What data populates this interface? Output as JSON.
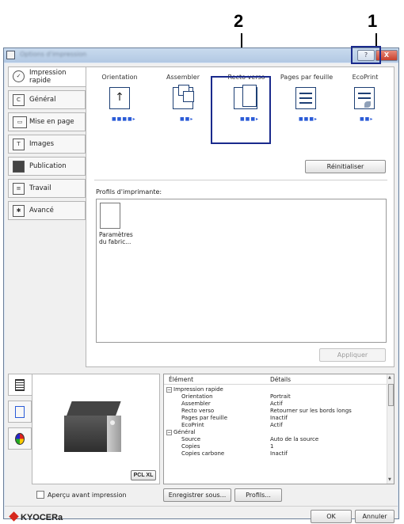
{
  "callouts": {
    "one": "1",
    "two": "2"
  },
  "window": {
    "title": "Options d'impression",
    "help": "?",
    "close": "X"
  },
  "sidebar": {
    "items": [
      {
        "label": "Impression rapide",
        "icon": "quick-print-icon"
      },
      {
        "label": "Général",
        "icon": "general-icon"
      },
      {
        "label": "Mise en page",
        "icon": "layout-icon"
      },
      {
        "label": "Images",
        "icon": "images-icon"
      },
      {
        "label": "Publication",
        "icon": "publishing-icon"
      },
      {
        "label": "Travail",
        "icon": "job-icon"
      },
      {
        "label": "Avancé",
        "icon": "advanced-icon"
      }
    ]
  },
  "quick": {
    "features": [
      {
        "label": "Orientation",
        "icon": "orientation-icon"
      },
      {
        "label": "Assembler",
        "icon": "collate-icon"
      },
      {
        "label": "Recto verso",
        "icon": "duplex-icon"
      },
      {
        "label": "Pages par feuille",
        "icon": "pages-per-sheet-icon"
      },
      {
        "label": "EcoPrint",
        "icon": "ecoprint-icon"
      }
    ],
    "reset": "Réinitialiser",
    "profiles_label": "Profils d'imprimante:",
    "profile_item": "Paramètres du fabric...",
    "apply": "Appliquer"
  },
  "printer": {
    "badge": "PCL XL"
  },
  "details": {
    "col_item": "Élément",
    "col_details": "Détails",
    "rows": [
      {
        "item": "Impression rapide",
        "value": "",
        "group": true
      },
      {
        "item": "Orientation",
        "value": "Portrait",
        "group": false
      },
      {
        "item": "Assembler",
        "value": "Actif",
        "group": false
      },
      {
        "item": "Recto verso",
        "value": "Retourner sur les bords longs",
        "group": false
      },
      {
        "item": "Pages par feuille",
        "value": "Inactif",
        "group": false
      },
      {
        "item": "EcoPrint",
        "value": "Actif",
        "group": false
      },
      {
        "item": "Général",
        "value": "",
        "group": true
      },
      {
        "item": "Source",
        "value": "Auto de la source",
        "group": false
      },
      {
        "item": "Copies",
        "value": "1",
        "group": false
      },
      {
        "item": "Copies carbone",
        "value": "Inactif",
        "group": false
      }
    ]
  },
  "footer": {
    "preview_checkbox": "Aperçu avant impression",
    "save_as": "Enregistrer sous...",
    "profiles": "Profils...",
    "ok": "OK",
    "cancel": "Annuler",
    "brand": "KYOCERa"
  },
  "colors": {
    "callout_box": "#1a2a8c",
    "brand": "#d6271c",
    "accent": "#2a5bd7"
  }
}
